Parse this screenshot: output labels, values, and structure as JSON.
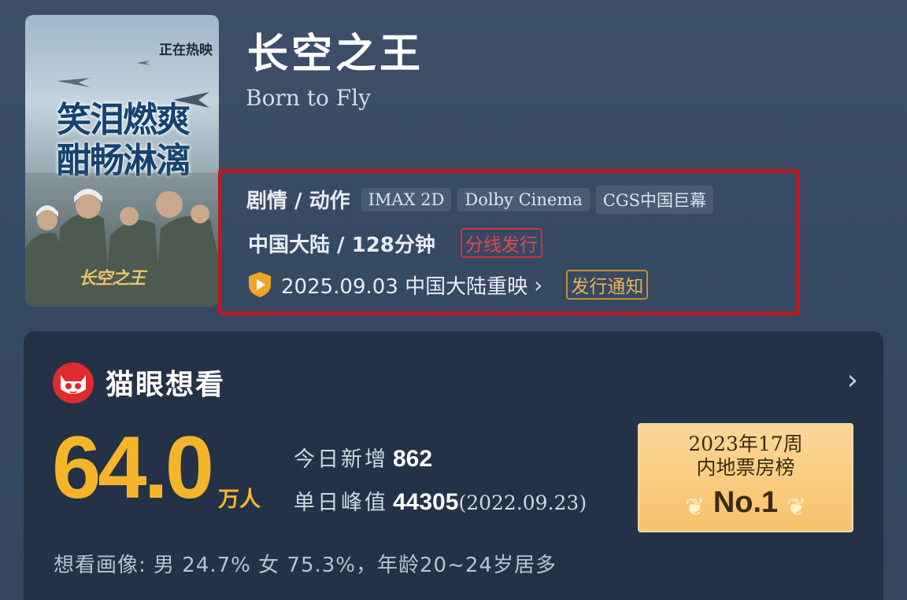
{
  "poster": {
    "badge": "正在热映",
    "slogan_line1": "笑泪燃爽",
    "slogan_line2": "酣畅淋漓",
    "logo": "长空之王"
  },
  "movie": {
    "title": "长空之王",
    "english_title": "Born to Fly"
  },
  "info": {
    "genre": "剧情 / 动作",
    "tags": [
      "IMAX 2D",
      "Dolby Cinema",
      "CGS中国巨幕"
    ],
    "region_duration": "中国大陆 / 128分钟",
    "distribution_badge": "分线发行",
    "release": "2025.09.03 中国大陆重映",
    "notice_badge": "发行通知",
    "accent_colors": {
      "border": "#b61c24",
      "dist": "#e5474e",
      "notice": "#eab454"
    }
  },
  "want": {
    "header": "猫眼想看",
    "count": "64.0",
    "unit": "万人",
    "today_label": "今日新增",
    "today_value": "862",
    "peak_label": "单日峰值",
    "peak_value": "44305",
    "peak_date": "(2022.09.23)",
    "rank_line1": "2023年17周",
    "rank_line2": "内地票房榜",
    "rank_value": "No.1",
    "portrait": "想看画像: 男 24.7% 女 75.3%，年龄20~24岁居多"
  }
}
